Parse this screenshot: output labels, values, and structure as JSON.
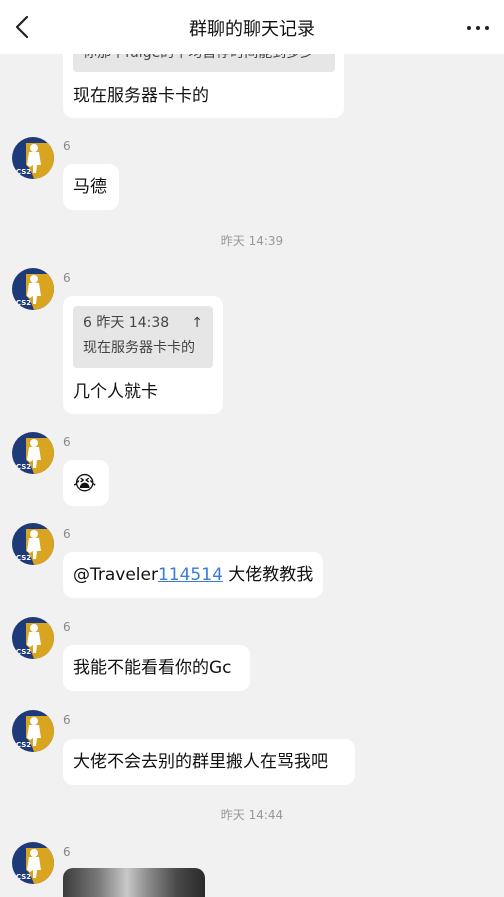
{
  "header": {
    "title": "群聊的聊天记录",
    "back_icon": "chevron-left-icon",
    "more_icon": "more-dots-icon"
  },
  "messages": [
    {
      "quote_partial": "你那个fulge的平均首停时间能到多少",
      "text": "现在服务器卡卡的"
    },
    {
      "sender": "6",
      "text": "马德"
    },
    {
      "timestamp": "昨天 14:39"
    },
    {
      "sender": "6",
      "quote_header": "6 昨天 14:38",
      "quote_arrow": "↑",
      "quote_text": "现在服务器卡卡的",
      "text": "几个人就卡"
    },
    {
      "sender": "6",
      "emoji": "😭"
    },
    {
      "sender": "6",
      "mention_prefix": "@Traveler",
      "mention_link": "114514",
      "text_suffix": " 大佬教教我"
    },
    {
      "sender": "6",
      "text": "我能不能看看你的Gc"
    },
    {
      "sender": "6",
      "text": "大佬不会去别的群里搬人在骂我吧"
    },
    {
      "timestamp": "昨天 14:44"
    },
    {
      "sender": "6",
      "image": "photo-thumbnail"
    }
  ],
  "colors": {
    "avatar_blue": "#1e3a78",
    "avatar_gold": "#d9a521",
    "link": "#3a7bd5",
    "background": "#f1f1f1"
  }
}
